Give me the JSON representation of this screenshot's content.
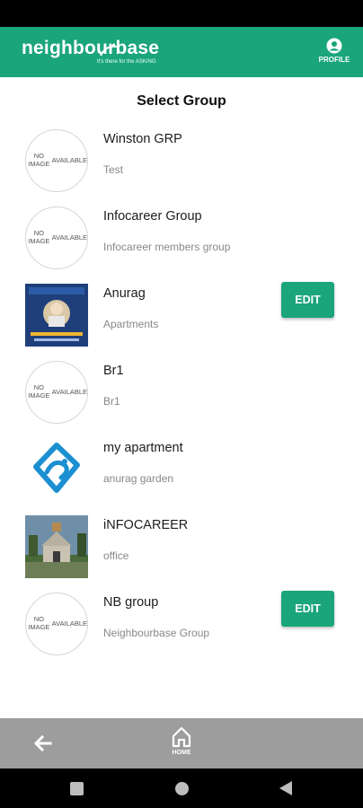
{
  "app": {
    "logo_text": "neighbourbase",
    "logo_tagline": "It's there for the ASKING",
    "profile_label": "PROFILE"
  },
  "page": {
    "title": "Select Group"
  },
  "no_image_text": "NO IMAGE AVAILABLE",
  "groups": [
    {
      "name": "Winston GRP",
      "description": "Test",
      "image": "none",
      "editable": false
    },
    {
      "name": "Infocareer Group",
      "description": "Infocareer members group",
      "image": "none",
      "editable": false
    },
    {
      "name": "Anurag",
      "description": "Apartments",
      "image": "engineers-day-poster",
      "editable": true,
      "edit_label": "EDIT"
    },
    {
      "name": "Br1",
      "description": "Br1",
      "image": "none",
      "editable": false
    },
    {
      "name": "my apartment",
      "description": "anurag garden",
      "image": "blue-swirl-logo",
      "editable": false
    },
    {
      "name": "iNFOCAREER",
      "description": "office",
      "image": "temple-photo",
      "editable": false
    },
    {
      "name": "NB group",
      "description": "Neighbourbase Group",
      "image": "none",
      "editable": true,
      "edit_label": "EDIT"
    }
  ],
  "bottom_nav": {
    "home_label": "HOME"
  },
  "colors": {
    "primary": "#1aa57a",
    "bottom_bar": "#9d9d9d"
  }
}
